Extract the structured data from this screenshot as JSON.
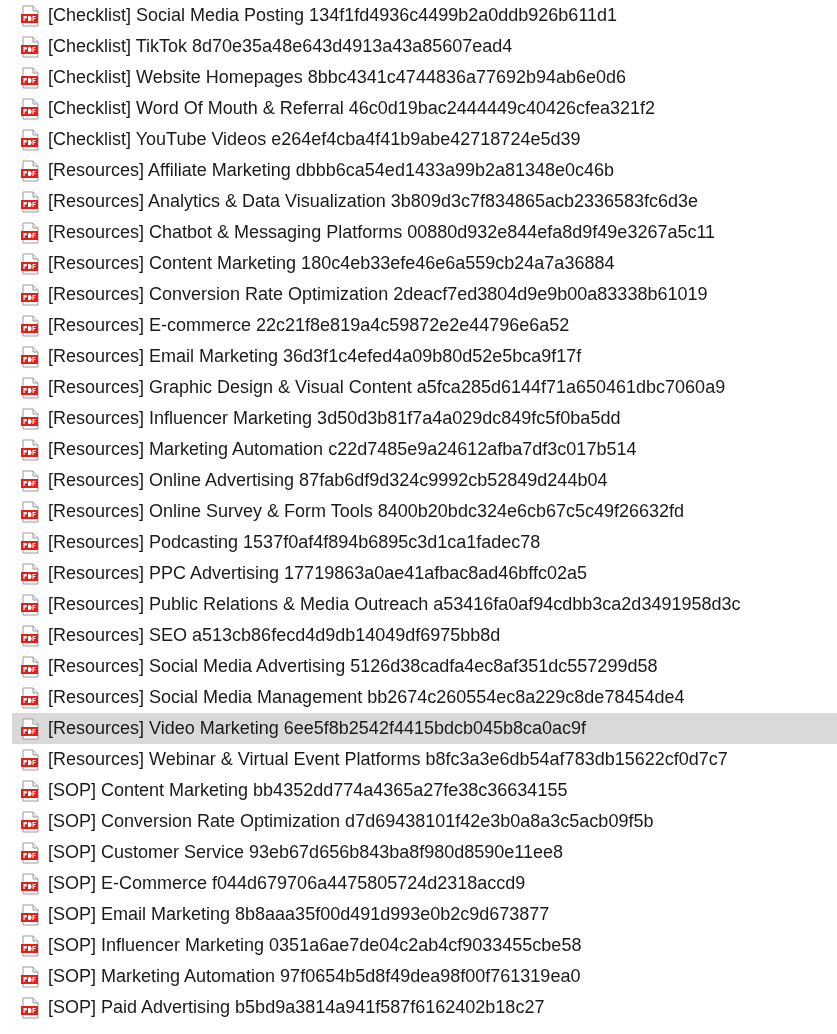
{
  "files": [
    {
      "name": "[Checklist] Social Media Posting 134f1fd4936c4499b2a0ddb926b611d1",
      "selected": false
    },
    {
      "name": "[Checklist] TikTok 8d70e35a48e643d4913a43a85607ead4",
      "selected": false
    },
    {
      "name": "[Checklist] Website Homepages 8bbc4341c4744836a77692b94ab6e0d6",
      "selected": false
    },
    {
      "name": "[Checklist] Word Of Mouth & Referral 46c0d19bac2444449c40426cfea321f2",
      "selected": false
    },
    {
      "name": "[Checklist] YouTube Videos e264ef4cba4f41b9abe42718724e5d39",
      "selected": false
    },
    {
      "name": "[Resources] Affiliate Marketing dbbb6ca54ed1433a99b2a81348e0c46b",
      "selected": false
    },
    {
      "name": "[Resources] Analytics & Data Visualization 3b809d3c7f834865acb2336583fc6d3e",
      "selected": false
    },
    {
      "name": "[Resources] Chatbot & Messaging Platforms 00880d932e844efa8d9f49e3267a5c11",
      "selected": false
    },
    {
      "name": "[Resources] Content Marketing 180c4eb33efe46e6a559cb24a7a36884",
      "selected": false
    },
    {
      "name": "[Resources] Conversion Rate Optimization 2deacf7ed3804d9e9b00a83338b61019",
      "selected": false
    },
    {
      "name": "[Resources] E-commerce 22c21f8e819a4c59872e2e44796e6a52",
      "selected": false
    },
    {
      "name": "[Resources] Email Marketing 36d3f1c4efed4a09b80d52e5bca9f17f",
      "selected": false
    },
    {
      "name": "[Resources] Graphic Design & Visual Content a5fca285d6144f71a650461dbc7060a9",
      "selected": false
    },
    {
      "name": "[Resources] Influencer Marketing 3d50d3b81f7a4a029dc849fc5f0ba5dd",
      "selected": false
    },
    {
      "name": "[Resources] Marketing Automation c22d7485e9a24612afba7df3c017b514",
      "selected": false
    },
    {
      "name": "[Resources] Online Advertising 87fab6df9d324c9992cb52849d244b04",
      "selected": false
    },
    {
      "name": "[Resources] Online Survey & Form Tools 8400b20bdc324e6cb67c5c49f26632fd",
      "selected": false
    },
    {
      "name": "[Resources] Podcasting 1537f0af4f894b6895c3d1ca1fadec78",
      "selected": false
    },
    {
      "name": "[Resources] PPC Advertising 17719863a0ae41afbac8ad46bffc02a5",
      "selected": false
    },
    {
      "name": "[Resources] Public Relations & Media Outreach a53416fa0af94cdbb3ca2d3491958d3c",
      "selected": false
    },
    {
      "name": "[Resources] SEO a513cb86fecd4d9db14049df6975bb8d",
      "selected": false
    },
    {
      "name": "[Resources] Social Media Advertising 5126d38cadfa4ec8af351dc557299d58",
      "selected": false
    },
    {
      "name": "[Resources] Social Media Management bb2674c260554ec8a229c8de78454de4",
      "selected": false
    },
    {
      "name": "[Resources] Video Marketing 6ee5f8b2542f4415bdcb045b8ca0ac9f",
      "selected": true
    },
    {
      "name": "[Resources] Webinar & Virtual Event Platforms b8fc3a3e6db54af783db15622cf0d7c7",
      "selected": false
    },
    {
      "name": "[SOP] Content Marketing bb4352dd774a4365a27fe38c36634155",
      "selected": false
    },
    {
      "name": "[SOP] Conversion Rate Optimization d7d69438101f42e3b0a8a3c5acb09f5b",
      "selected": false
    },
    {
      "name": "[SOP] Customer Service 93eb67d656b843ba8f980d8590e11ee8",
      "selected": false
    },
    {
      "name": "[SOP] E-Commerce f044d679706a4475805724d2318accd9",
      "selected": false
    },
    {
      "name": "[SOP] Email Marketing 8b8aaa35f00d491d993e0b2c9d673877",
      "selected": false
    },
    {
      "name": "[SOP] Influencer Marketing 0351a6ae7de04c2ab4cf9033455cbe58",
      "selected": false
    },
    {
      "name": "[SOP] Marketing Automation 97f0654b5d8f49dea98f00f761319ea0",
      "selected": false
    },
    {
      "name": "[SOP] Paid Advertising b5bd9a3814a941f587f6162402b18c27",
      "selected": false
    }
  ]
}
